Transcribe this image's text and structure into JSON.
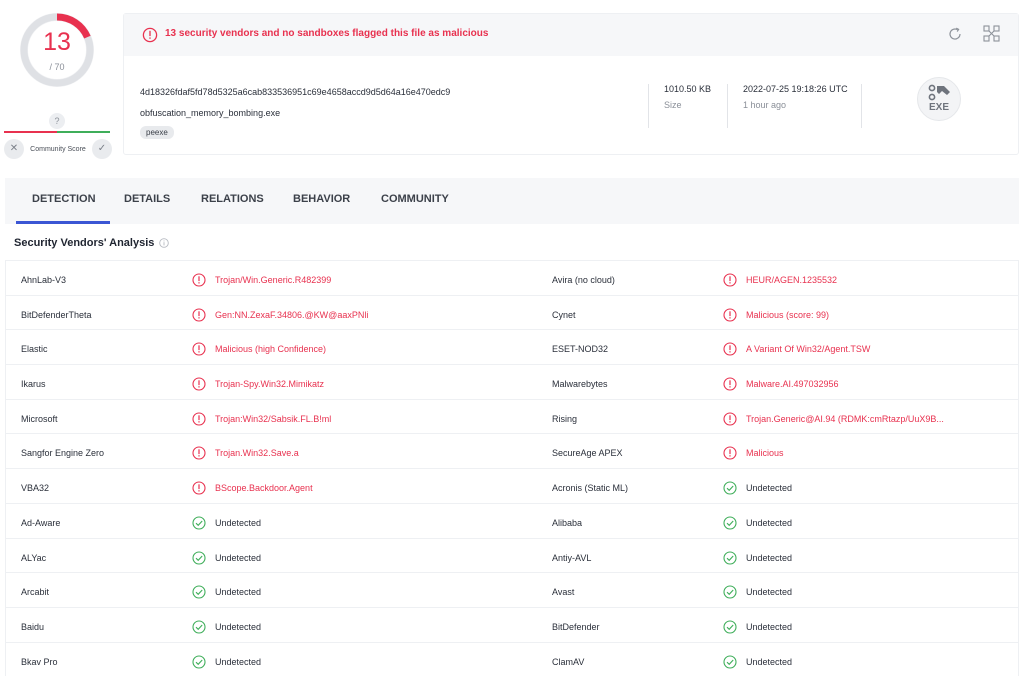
{
  "score": {
    "detections": "13",
    "total": "/ 70",
    "community_unknown": "?",
    "community_label": "Community Score",
    "detection_fraction": 0.186
  },
  "alert": {
    "text": "13 security vendors and no sandboxes flagged this file as malicious"
  },
  "file": {
    "sha256": "4d18326fdaf5fd78d5325a6cab833536951c69e4658accd9d5d64a16e470edc9",
    "name": "obfuscation_memory_bombing.exe",
    "tag": "peexe",
    "size": "1010.50 KB",
    "size_label": "Size",
    "date": "2022-07-25 19:18:26 UTC",
    "date_ago": "1 hour ago",
    "type_badge": "EXE"
  },
  "tabs": [
    "DETECTION",
    "DETAILS",
    "RELATIONS",
    "BEHAVIOR",
    "COMMUNITY"
  ],
  "section_title": "Security Vendors' Analysis",
  "colors": {
    "malicious": "#e8314f",
    "clean": "#3fae5a",
    "accent": "#3b56d4"
  },
  "vendors": [
    {
      "left": {
        "name": "AhnLab-V3",
        "result": "Trojan/Win.Generic.R482399",
        "status": "malicious"
      },
      "right": {
        "name": "Avira (no cloud)",
        "result": "HEUR/AGEN.1235532",
        "status": "malicious"
      }
    },
    {
      "left": {
        "name": "BitDefenderTheta",
        "result": "Gen:NN.ZexaF.34806.@KW@aaxPNli",
        "status": "malicious"
      },
      "right": {
        "name": "Cynet",
        "result": "Malicious (score: 99)",
        "status": "malicious"
      }
    },
    {
      "left": {
        "name": "Elastic",
        "result": "Malicious (high Confidence)",
        "status": "malicious"
      },
      "right": {
        "name": "ESET-NOD32",
        "result": "A Variant Of Win32/Agent.TSW",
        "status": "malicious"
      }
    },
    {
      "left": {
        "name": "Ikarus",
        "result": "Trojan-Spy.Win32.Mimikatz",
        "status": "malicious"
      },
      "right": {
        "name": "Malwarebytes",
        "result": "Malware.AI.497032956",
        "status": "malicious"
      }
    },
    {
      "left": {
        "name": "Microsoft",
        "result": "Trojan:Win32/Sabsik.FL.B!ml",
        "status": "malicious"
      },
      "right": {
        "name": "Rising",
        "result": "Trojan.Generic@AI.94 (RDMK:cmRtazp/UuX9B...",
        "status": "malicious"
      }
    },
    {
      "left": {
        "name": "Sangfor Engine Zero",
        "result": "Trojan.Win32.Save.a",
        "status": "malicious"
      },
      "right": {
        "name": "SecureAge APEX",
        "result": "Malicious",
        "status": "malicious"
      }
    },
    {
      "left": {
        "name": "VBA32",
        "result": "BScope.Backdoor.Agent",
        "status": "malicious"
      },
      "right": {
        "name": "Acronis (Static ML)",
        "result": "Undetected",
        "status": "undetected"
      }
    },
    {
      "left": {
        "name": "Ad-Aware",
        "result": "Undetected",
        "status": "undetected"
      },
      "right": {
        "name": "Alibaba",
        "result": "Undetected",
        "status": "undetected"
      }
    },
    {
      "left": {
        "name": "ALYac",
        "result": "Undetected",
        "status": "undetected"
      },
      "right": {
        "name": "Antiy-AVL",
        "result": "Undetected",
        "status": "undetected"
      }
    },
    {
      "left": {
        "name": "Arcabit",
        "result": "Undetected",
        "status": "undetected"
      },
      "right": {
        "name": "Avast",
        "result": "Undetected",
        "status": "undetected"
      }
    },
    {
      "left": {
        "name": "Baidu",
        "result": "Undetected",
        "status": "undetected"
      },
      "right": {
        "name": "BitDefender",
        "result": "Undetected",
        "status": "undetected"
      }
    },
    {
      "left": {
        "name": "Bkav Pro",
        "result": "Undetected",
        "status": "undetected"
      },
      "right": {
        "name": "ClamAV",
        "result": "Undetected",
        "status": "undetected"
      }
    }
  ]
}
